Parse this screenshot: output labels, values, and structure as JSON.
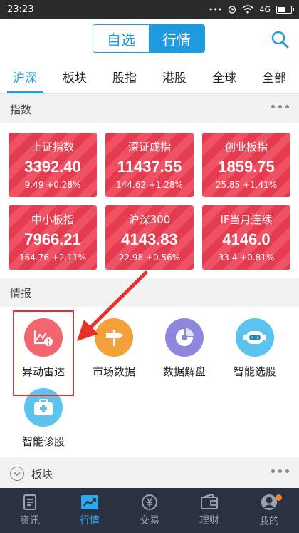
{
  "status": {
    "time": "23:23",
    "net": "4G"
  },
  "header": {
    "seg_left": "自选",
    "seg_right": "行情"
  },
  "tabs": [
    "沪深",
    "板块",
    "股指",
    "港股",
    "全球",
    "全部"
  ],
  "index_section": {
    "title": "指数"
  },
  "indices": [
    {
      "name": "上证指数",
      "value": "3392.40",
      "change": "9.49 +0.28%"
    },
    {
      "name": "深证成指",
      "value": "11437.55",
      "change": "144.62 +1.28%"
    },
    {
      "name": "创业板指",
      "value": "1859.75",
      "change": "25.85 +1.41%"
    },
    {
      "name": "中小板指",
      "value": "7966.21",
      "change": "164.76 +2.11%"
    },
    {
      "name": "沪深300",
      "value": "4143.83",
      "change": "22.98 +0.56%"
    },
    {
      "name": "IF当月连续",
      "value": "4146.0",
      "change": "33.4 +0.81%"
    }
  ],
  "info_section": {
    "title": "情报"
  },
  "apps": [
    {
      "label": "异动雷达",
      "icon": "radar-chart-icon",
      "color": "#f0656e"
    },
    {
      "label": "市场数据",
      "icon": "signpost-icon",
      "color": "#f5a03a"
    },
    {
      "label": "数据解盘",
      "icon": "pie-chart-icon",
      "color": "#8f86dd"
    },
    {
      "label": "智能选股",
      "icon": "robot-icon",
      "color": "#5bc3ee"
    },
    {
      "label": "智能诊股",
      "icon": "medkit-icon",
      "color": "#5bc3ee"
    }
  ],
  "board_section": {
    "title": "板块"
  },
  "bottom_nav": [
    "资讯",
    "行情",
    "交易",
    "理财",
    "我的"
  ],
  "colors": {
    "accent": "#1e9be0",
    "card": "#e53b4f",
    "highlight": "#e8302a",
    "nav_bg": "#2a3140"
  }
}
